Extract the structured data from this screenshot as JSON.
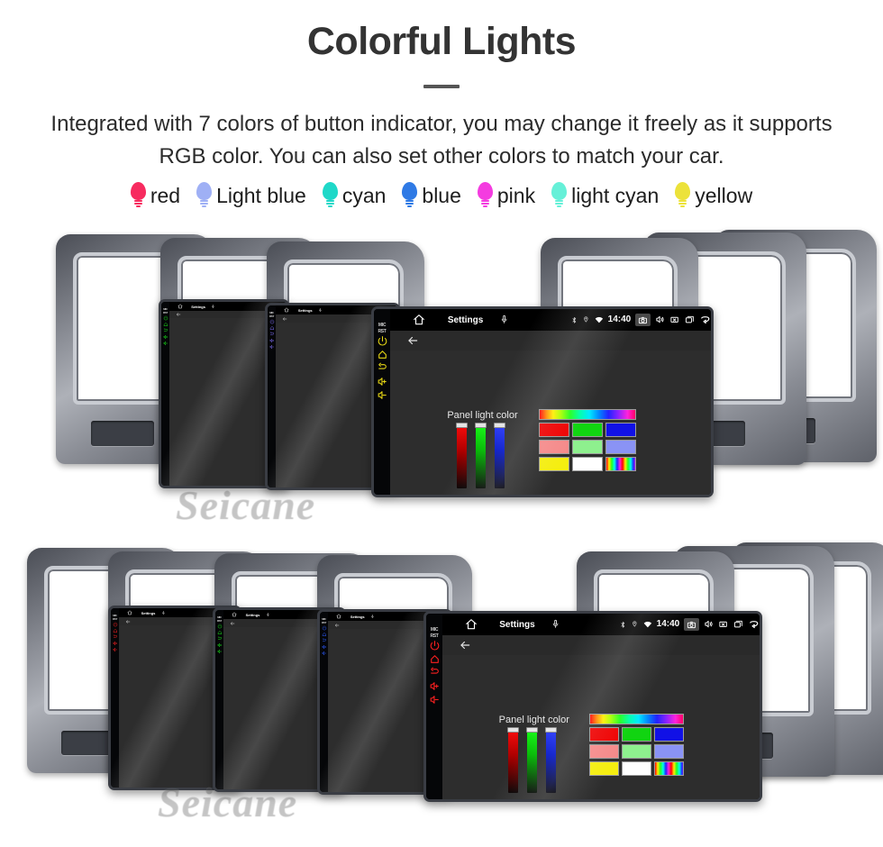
{
  "header": {
    "title": "Colorful Lights",
    "subtitle": "Integrated with 7 colors of button indicator, you may change it freely as it supports RGB color. You can also set other colors to match your car.",
    "divider_color": "#555555",
    "title_color": "#333333"
  },
  "legend": {
    "items": [
      {
        "label": "red",
        "color": "#f72b5f",
        "icon": "bulb-icon"
      },
      {
        "label": "Light blue",
        "color": "#9fb0f5",
        "icon": "bulb-icon"
      },
      {
        "label": "cyan",
        "color": "#1fd8c8",
        "icon": "bulb-icon"
      },
      {
        "label": "blue",
        "color": "#2f7ae5",
        "icon": "bulb-icon"
      },
      {
        "label": "pink",
        "color": "#f43ce0",
        "icon": "bulb-icon"
      },
      {
        "label": "light cyan",
        "color": "#66f0d8",
        "icon": "bulb-icon"
      },
      {
        "label": "yellow",
        "color": "#ece23a",
        "icon": "bulb-icon"
      }
    ]
  },
  "watermark": {
    "text": "Seicane"
  },
  "device": {
    "statusbar": {
      "app_title": "Settings",
      "time": "14:40",
      "home_icon": "home-icon",
      "mic_icon": "microphone-icon",
      "bluetooth_icon": "bluetooth-icon",
      "location_icon": "location-pin-icon",
      "wifi_icon": "wifi-icon",
      "camera_icon": "camera-icon",
      "volume_icon": "speaker-icon",
      "close_icon": "close-box-icon",
      "recents_icon": "recents-icon",
      "back_icon": "back-arrow-icon"
    },
    "actionbar": {
      "back_icon": "back-arrow-icon"
    },
    "panel": {
      "label": "Panel light color",
      "sliders": [
        {
          "name": "red-slider",
          "channel": "R",
          "value": 100
        },
        {
          "name": "green-slider",
          "channel": "G",
          "value": 100
        },
        {
          "name": "blue-slider",
          "channel": "B",
          "value": 100
        }
      ],
      "swatches": {
        "rainbow_bar": "rainbow-gradient",
        "rows": [
          [
            {
              "name": "swatch-red",
              "color": "#ee0000"
            },
            {
              "name": "swatch-green",
              "color": "#11d411"
            },
            {
              "name": "swatch-blue",
              "color": "#1111e6"
            }
          ],
          [
            {
              "name": "swatch-light-red",
              "color": "#f58a8a"
            },
            {
              "name": "swatch-light-green",
              "color": "#8ef08e"
            },
            {
              "name": "swatch-light-blue",
              "color": "#8a93f5"
            }
          ],
          [
            {
              "name": "swatch-yellow",
              "color": "#f5ee10"
            },
            {
              "name": "swatch-white",
              "color": "#ffffff"
            },
            {
              "name": "swatch-rainbow",
              "color": "rainbow-stripes"
            }
          ]
        ]
      }
    },
    "side_buttons": {
      "labels": [
        "MIC",
        "RST"
      ],
      "icons": [
        "power-icon",
        "home-icon",
        "back-icon",
        "volume-up-icon",
        "volume-down-icon"
      ]
    }
  },
  "stacks": [
    {
      "name": "stack-top",
      "units": [
        {
          "name": "unit-top-1",
          "button_color": "#19e019",
          "detail": "bezel-only"
        },
        {
          "name": "unit-top-2",
          "button_color": "#19e019",
          "detail": "partial"
        },
        {
          "name": "unit-top-3",
          "button_color": "#7b6bf0",
          "detail": "partial"
        },
        {
          "name": "unit-top-4",
          "button_color": "#e8d814",
          "detail": "full"
        },
        {
          "name": "unit-top-5",
          "button_color": "#19e019",
          "detail": "bezel-only"
        },
        {
          "name": "unit-top-6",
          "button_color": "#19e019",
          "detail": "bezel-only"
        }
      ]
    },
    {
      "name": "stack-bottom",
      "units": [
        {
          "name": "unit-bottom-1",
          "button_color": "#ff2020",
          "detail": "bezel-only"
        },
        {
          "name": "unit-bottom-2",
          "button_color": "#ff2020",
          "detail": "partial"
        },
        {
          "name": "unit-bottom-3",
          "button_color": "#19e019",
          "detail": "partial"
        },
        {
          "name": "unit-bottom-4",
          "button_color": "#2b5bff",
          "detail": "partial"
        },
        {
          "name": "unit-bottom-5",
          "button_color": "#ff2020",
          "detail": "full"
        },
        {
          "name": "unit-bottom-6",
          "button_color": "#ff2020",
          "detail": "bezel-only"
        },
        {
          "name": "unit-bottom-7",
          "button_color": "#ff2020",
          "detail": "bezel-only"
        }
      ]
    }
  ]
}
